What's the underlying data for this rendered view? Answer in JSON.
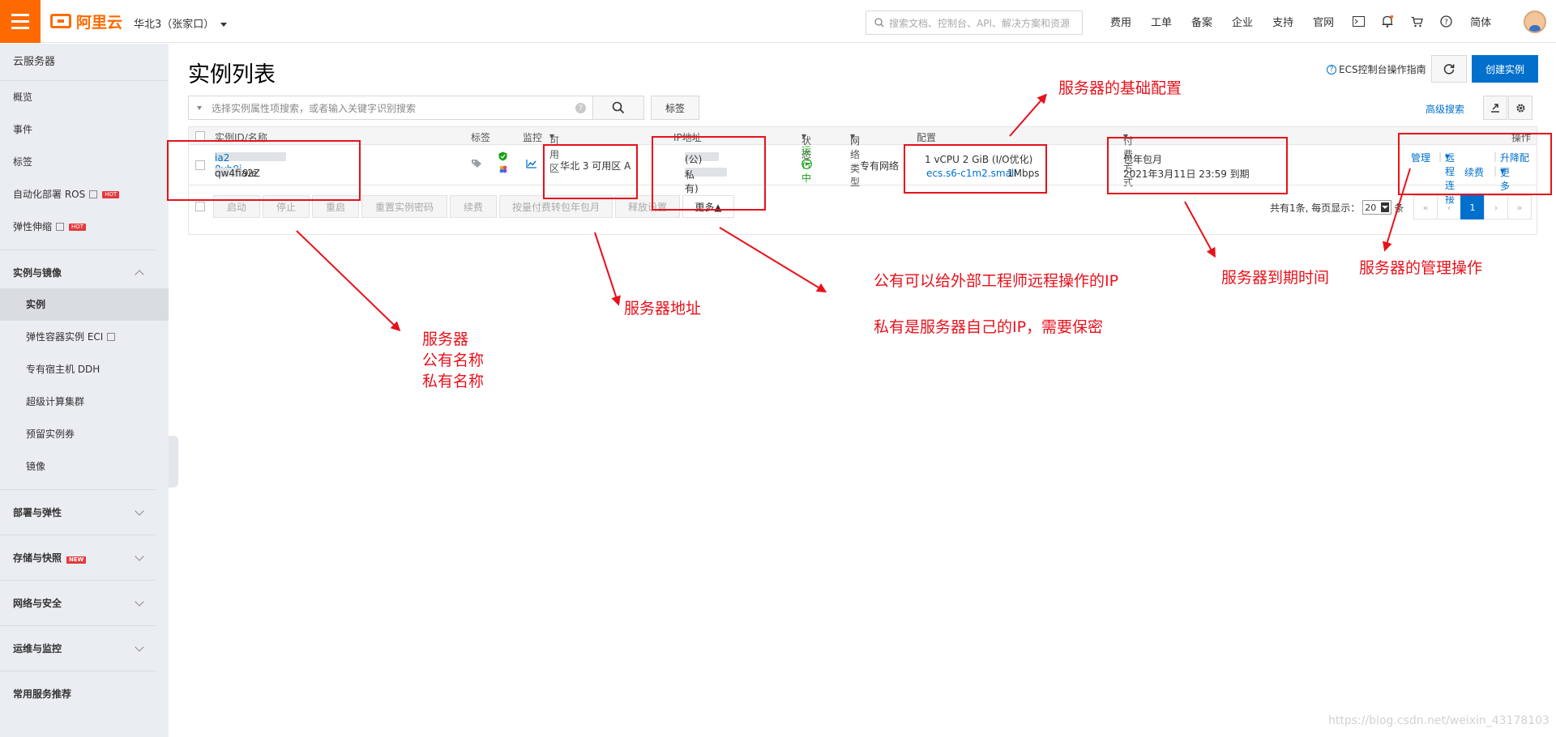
{
  "topbar": {
    "brand": "阿里云",
    "region": "华北3（张家口）",
    "search_placeholder": "搜索文档、控制台、API、解决方案和资源",
    "nav": [
      "费用",
      "工单",
      "备案",
      "企业",
      "支持",
      "官网"
    ],
    "lang": "简体"
  },
  "sidebar": {
    "title": "云服务器",
    "top_items": [
      "概览",
      "事件",
      "标签"
    ],
    "ros": "自动化部署 ROS",
    "scaling": "弹性伸缩",
    "hot": "HOT",
    "group_instances": "实例与镜像",
    "sub_items": [
      "实例",
      "弹性容器实例 ECI",
      "专有宿主机 DDH",
      "超级计算集群",
      "预留实例券",
      "镜像"
    ],
    "groups": [
      "部署与弹性",
      "存储与快照",
      "网络与安全",
      "运维与监控"
    ],
    "new_badge": "NEW",
    "recommend": "常用服务推荐"
  },
  "main": {
    "title": "实例列表",
    "guide": "ECS控制台操作指南",
    "create": "创建实例",
    "search_placeholder": "选择实例属性项搜索，或者输入关键字识别搜索",
    "tag_button": "标签",
    "advanced_search": "高级搜索"
  },
  "table": {
    "headers": {
      "id": "实例ID/名称",
      "tag": "标签",
      "monitor": "监控",
      "zone": "可用区",
      "ip": "IP地址",
      "status": "状态",
      "network": "网络类型",
      "config": "配置",
      "billing": "付费方式",
      "actions": "操作"
    },
    "row": {
      "id_prefix": "i-8vb9i",
      "id_suffix": "ia2",
      "name_prefix": "iZ8vb9ie",
      "name_suffix": "qw4fia2Z",
      "zone": "华北 3 可用区 A",
      "ip_public_prefix": "39.1",
      "ip_public_suffix": "(公)",
      "ip_private_prefix": "172",
      "ip_private_suffix": "私有)",
      "status": "运行中",
      "network": "专有网络",
      "config_line1": "1 vCPU 2 GiB (I/O优化)",
      "config_type": "ecs.s6-c1m2.small",
      "config_bw": "1Mbps",
      "billing_line1": "包年包月",
      "billing_line2": "2021年3月11日 23:59 到期",
      "action_manage": "管理",
      "action_remote": "远程连接",
      "action_upgrade": "升降配",
      "action_renew": "续费",
      "action_more": "更多"
    },
    "footer_buttons": [
      "启动",
      "停止",
      "重启",
      "重置实例密码",
      "续费",
      "按量付费转包年包月",
      "释放设置",
      "更多▲"
    ],
    "pagination": {
      "info": "共有1条, 每页显示：",
      "page_size": "20",
      "unit": "条",
      "first": "«",
      "prev": "‹",
      "current": "1",
      "next": "›",
      "last": "»"
    }
  },
  "annotations": {
    "config": "服务器的基础配置",
    "server_names": [
      "服务器",
      "公有名称",
      "私有名称"
    ],
    "zone": "服务器地址",
    "ip_public": "公有可以给外部工程师远程操作的IP",
    "ip_private": "私有是服务器自己的IP，需要保密",
    "expiry": "服务器到期时间",
    "manage": "服务器的管理操作"
  },
  "watermark": "https://blog.csdn.net/weixin_43178103",
  "colors": {
    "accent": "#ff6a00",
    "link": "#0070cc",
    "annotation": "#e8111b",
    "running": "#1aa11a"
  }
}
